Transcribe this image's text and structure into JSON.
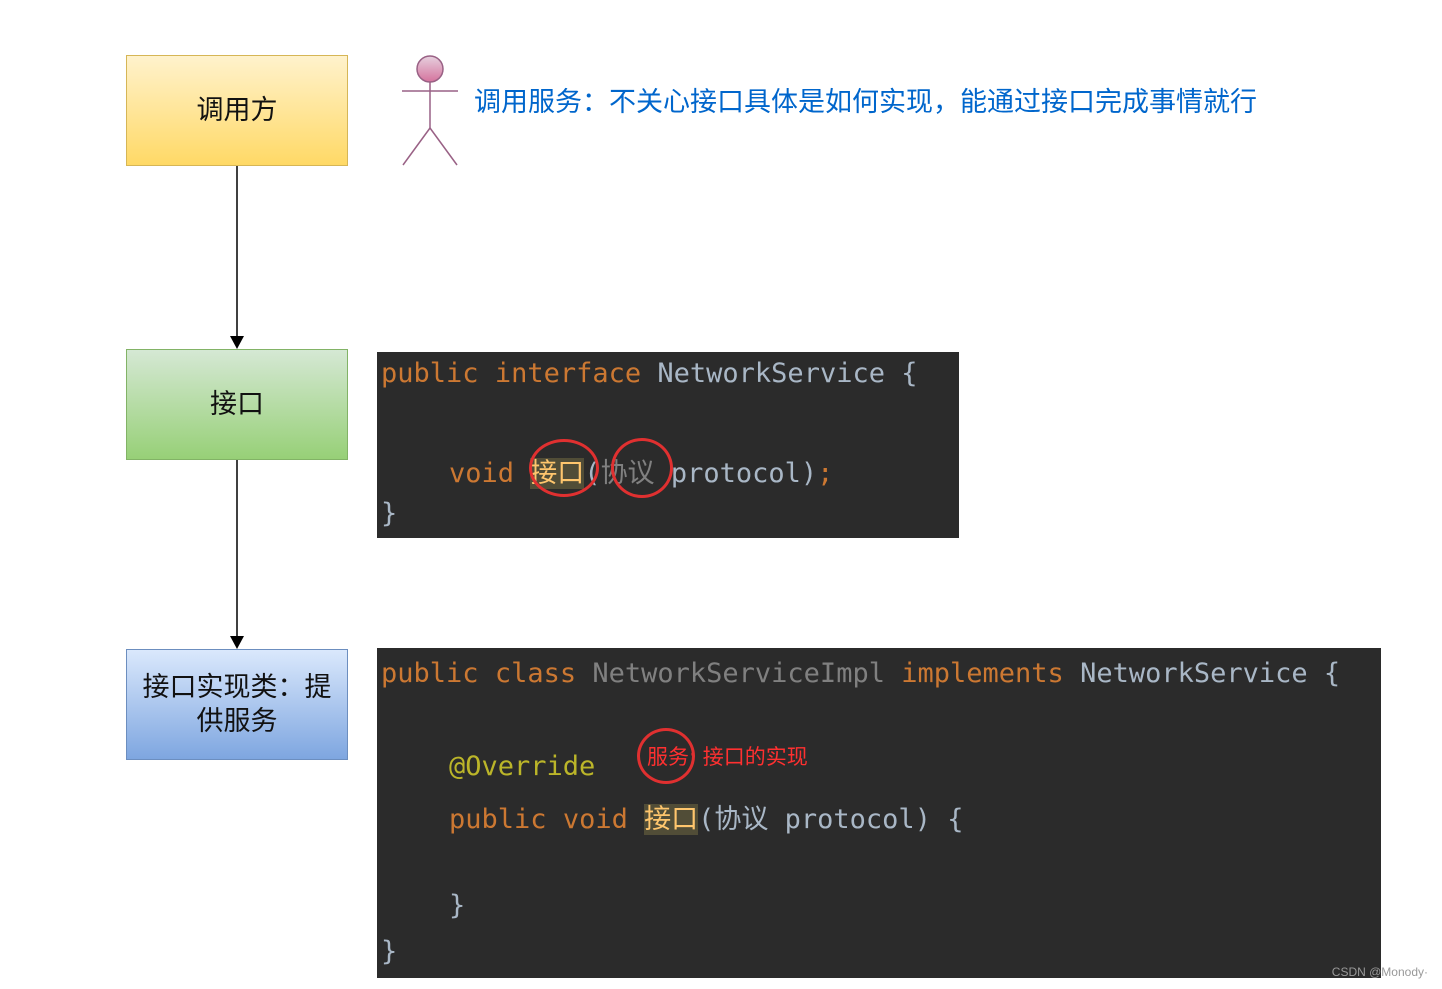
{
  "boxes": {
    "caller": "调用方",
    "interface": "接口",
    "impl": "接口实现类：提供服务"
  },
  "actor": {
    "caption": "调用服务：不关心接口具体是如何实现，能通过接口完成事情就行"
  },
  "code_interface": {
    "line1": {
      "kw1": "public",
      "kw2": "interface",
      "name": "NetworkService",
      "brace": "{"
    },
    "line2": {
      "kw": "void",
      "method": "接口",
      "open": "(",
      "param_type": "协议",
      "param": "protocol",
      "close": ")",
      "semi": ";"
    },
    "line3": "}"
  },
  "code_impl": {
    "line1": {
      "kw1": "public",
      "kw2": "class",
      "name": "NetworkServiceImpl",
      "kw3": "implements",
      "iface": "NetworkService",
      "brace": "{"
    },
    "annotation": "@Override",
    "line3": {
      "kw1": "public",
      "kw2": "void",
      "method": "接口",
      "open": "(",
      "param_type": "协议",
      "param": "protocol",
      "close": ")",
      "brace": "{"
    },
    "inner_close": "}",
    "outer_close": "}",
    "note_circled": "服务",
    "note_rest": ": 接口的实现"
  },
  "watermark": "CSDN @Monody·",
  "colors": {
    "caption": "#0066cc",
    "ring": "#e03030",
    "code_bg": "#2b2b2b",
    "keyword": "#cc7832"
  }
}
